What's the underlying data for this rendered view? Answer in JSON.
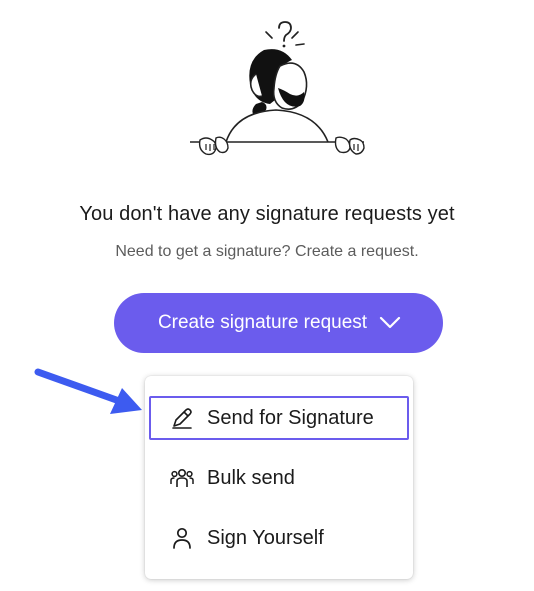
{
  "empty_state": {
    "title": "You don't have any signature requests yet",
    "subtitle": "Need to get a signature? Create a request.",
    "illustration": "confused-person-peeking-over-wall"
  },
  "create_button": {
    "label": "Create signature request",
    "icon": "chevron-down-icon",
    "color": "#6b5ced"
  },
  "menu": {
    "items": [
      {
        "label": "Send for Signature",
        "icon": "pen-icon",
        "highlighted": true
      },
      {
        "label": "Bulk send",
        "icon": "group-icon",
        "highlighted": false
      },
      {
        "label": "Sign Yourself",
        "icon": "person-icon",
        "highlighted": false
      }
    ],
    "highlight_color": "#6b5ced"
  },
  "annotation": {
    "arrow_color": "#3d5bf0"
  }
}
